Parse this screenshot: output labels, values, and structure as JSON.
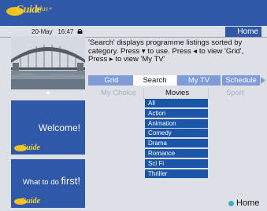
{
  "header": {
    "logo_text": "Guide",
    "logo_plus": "plus+",
    "home_label": "Home",
    "date": "20-May",
    "time": "16:47"
  },
  "info": {
    "line1": "'Search' displays programme listings sorted by",
    "line2": "category. Press ▾ to use. Press ◂ to view 'Grid',",
    "line3": "Press ▸ to view 'My TV'"
  },
  "tabs": [
    {
      "label": "Grid",
      "active": false
    },
    {
      "label": "Search",
      "active": true
    },
    {
      "label": "My TV",
      "active": false
    },
    {
      "label": "Schedule",
      "active": false
    }
  ],
  "subtabs": [
    {
      "label": "My Choice",
      "active": false
    },
    {
      "label": "Movies",
      "active": true
    },
    {
      "label": "Sport",
      "active": false
    }
  ],
  "categories": [
    "All",
    "Action",
    "Animation",
    "Comedy",
    "Drama",
    "Romance",
    "Sci Fi",
    "Thriller"
  ],
  "panels": {
    "welcome": "Welcome!",
    "what_to_do_a": "What to do ",
    "what_to_do_b": "first!"
  },
  "footer": {
    "home_label": "Home"
  },
  "colors": {
    "brand_blue": "#2f58a8",
    "tab_blue": "#7f9bd8",
    "list_blue": "#1a55a8",
    "logo_yellow": "#f2c21a",
    "home_dot": "#3ab1c9"
  }
}
